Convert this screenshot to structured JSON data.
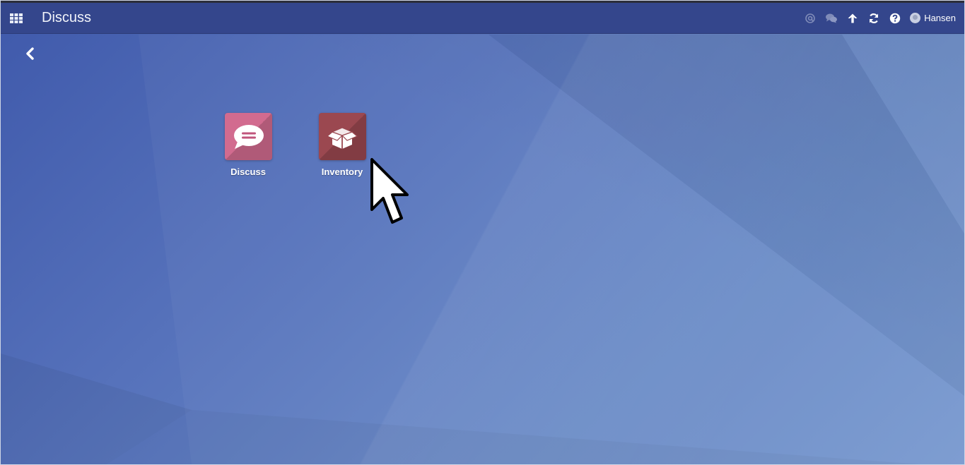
{
  "topbar": {
    "app_title": "Discuss",
    "apps_menu_icon": "grid-icon",
    "systray": {
      "icons": [
        "at-mention-icon",
        "chat-bubbles-icon",
        "arrow-up-icon",
        "refresh-icon",
        "help-icon"
      ],
      "user_name": "Hansen"
    },
    "background_color": "#34468c"
  },
  "back_button_icon": "chevron-left-icon",
  "apps": [
    {
      "label": "Discuss",
      "icon": "speech-bubble-icon",
      "color": "#d26b8f"
    },
    {
      "label": "Inventory",
      "icon": "open-box-icon",
      "color": "#9b4850"
    }
  ],
  "cursor_icon": "mouse-pointer-icon"
}
